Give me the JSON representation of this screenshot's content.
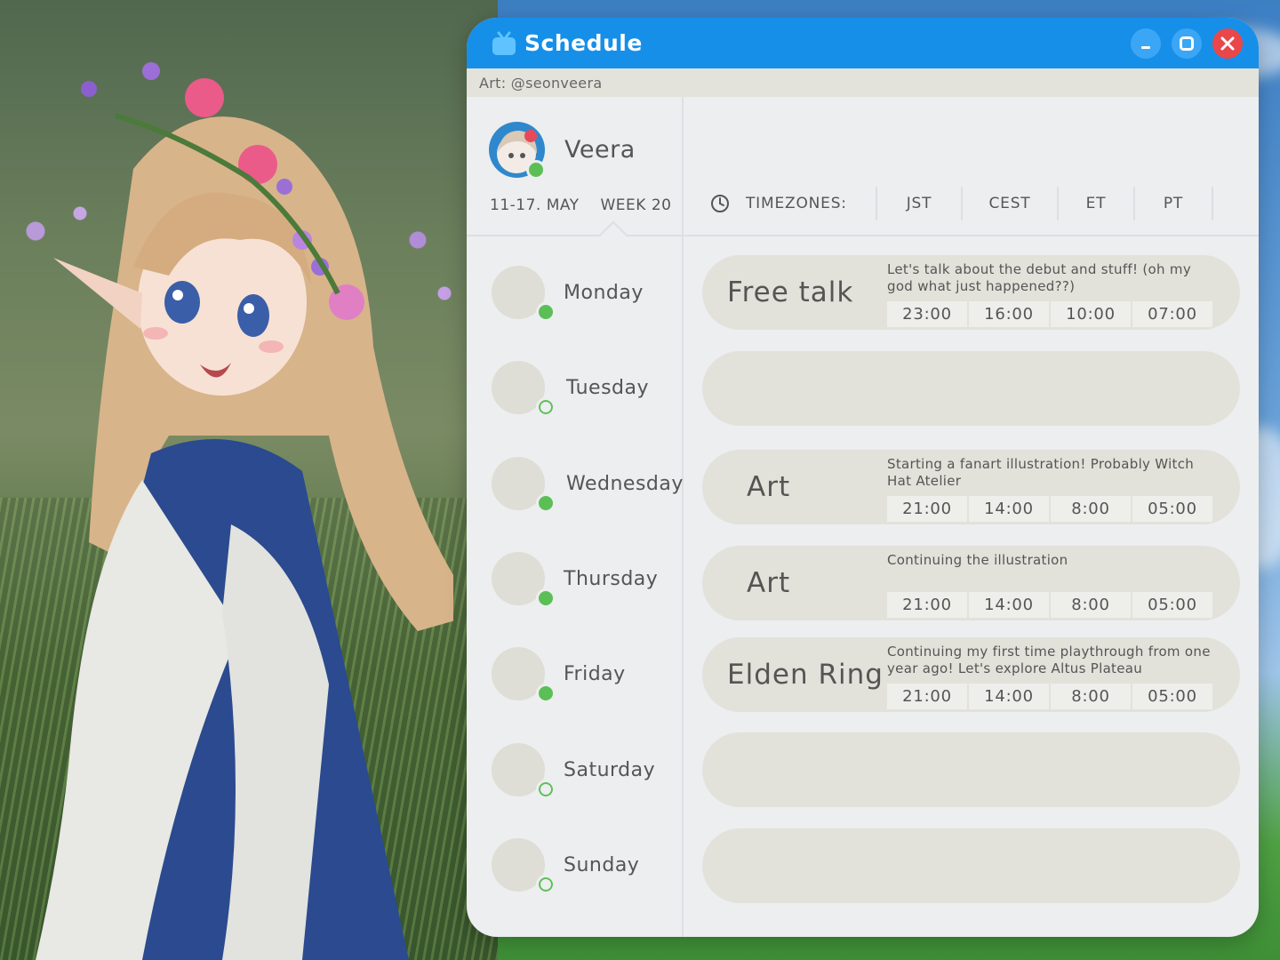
{
  "window": {
    "title": "Schedule",
    "credit": "Art: @seonveera"
  },
  "profile": {
    "name": "Veera",
    "status": "online",
    "date_range": "11-17. MAY",
    "week": "WEEK 20"
  },
  "timezones": {
    "label": "TIMEZONES:",
    "zones": [
      "JST",
      "CEST",
      "ET",
      "PT"
    ]
  },
  "days": [
    {
      "name": "Monday",
      "active": true
    },
    {
      "name": "Tuesday",
      "active": false
    },
    {
      "name": "Wednesday",
      "active": true
    },
    {
      "name": "Thursday",
      "active": true
    },
    {
      "name": "Friday",
      "active": true
    },
    {
      "name": "Saturday",
      "active": false
    },
    {
      "name": "Sunday",
      "active": false
    }
  ],
  "slots": [
    {
      "title": "Free talk",
      "desc": "Let's talk about the debut and stuff! (oh my god what just happened??)",
      "times": [
        "23:00",
        "16:00",
        "10:00",
        "07:00"
      ]
    },
    {
      "title": "",
      "desc": "",
      "times": []
    },
    {
      "title": "Art",
      "desc": "Starting a fanart illustration! Probably Witch Hat Atelier",
      "times": [
        "21:00",
        "14:00",
        "8:00",
        "05:00"
      ]
    },
    {
      "title": "Art",
      "desc": "Continuing the illustration",
      "times": [
        "21:00",
        "14:00",
        "8:00",
        "05:00"
      ]
    },
    {
      "title": "Elden Ring",
      "desc": "Continuing my first time playthrough from one year ago! Let's explore Altus Plateau",
      "times": [
        "21:00",
        "14:00",
        "8:00",
        "05:00"
      ]
    },
    {
      "title": "",
      "desc": "",
      "times": []
    },
    {
      "title": "",
      "desc": "",
      "times": []
    }
  ],
  "colors": {
    "titlebar": "#168fe9",
    "close": "#e9474a",
    "online": "#5bbf55",
    "panel": "#eceef0",
    "slot": "#e2e2db"
  },
  "icons": {
    "app": "tv-icon",
    "clock": "clock-icon",
    "minimize": "minimize-icon",
    "maximize": "maximize-icon",
    "close": "close-icon"
  }
}
